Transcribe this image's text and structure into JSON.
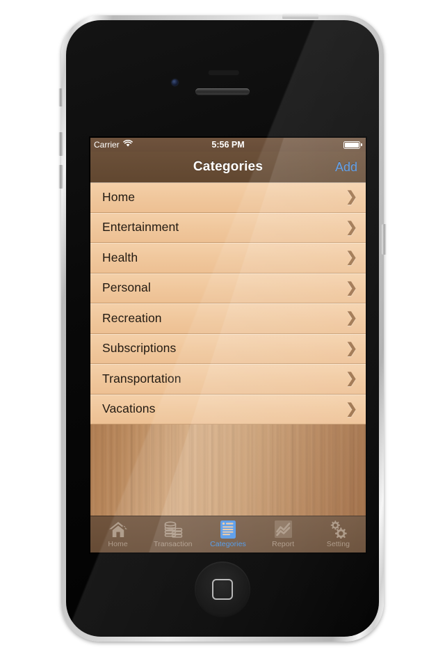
{
  "status_bar": {
    "carrier": "Carrier",
    "wifi_icon": "wifi-icon",
    "time": "5:56 PM",
    "battery_icon": "battery-full-icon"
  },
  "nav_bar": {
    "title": "Categories",
    "add_label": "Add"
  },
  "categories": [
    {
      "label": "Home",
      "chevron": "❯"
    },
    {
      "label": "Entertainment",
      "chevron": "❯"
    },
    {
      "label": "Health",
      "chevron": "❯"
    },
    {
      "label": "Personal",
      "chevron": "❯"
    },
    {
      "label": "Recreation",
      "chevron": "❯"
    },
    {
      "label": "Subscriptions",
      "chevron": "❯"
    },
    {
      "label": "Transportation",
      "chevron": "❯"
    },
    {
      "label": "Vacations",
      "chevron": "❯"
    }
  ],
  "tab_bar": {
    "tabs": [
      {
        "label": "Home",
        "icon": "house-icon",
        "active": false
      },
      {
        "label": "Transaction",
        "icon": "coins-icon",
        "active": false
      },
      {
        "label": "Categories",
        "icon": "document-icon",
        "active": true
      },
      {
        "label": "Report",
        "icon": "line-chart-icon",
        "active": false
      },
      {
        "label": "Setting",
        "icon": "gears-icon",
        "active": false
      }
    ]
  },
  "colors": {
    "nav_bar": "#6b5039",
    "status_bar": "#6f533d",
    "row_background": "#f0c79c",
    "row_separator": "#c79a6d",
    "accent_blue": "#4a93e8",
    "tab_inactive": "#a99582",
    "wood": "#bb8a5e"
  }
}
